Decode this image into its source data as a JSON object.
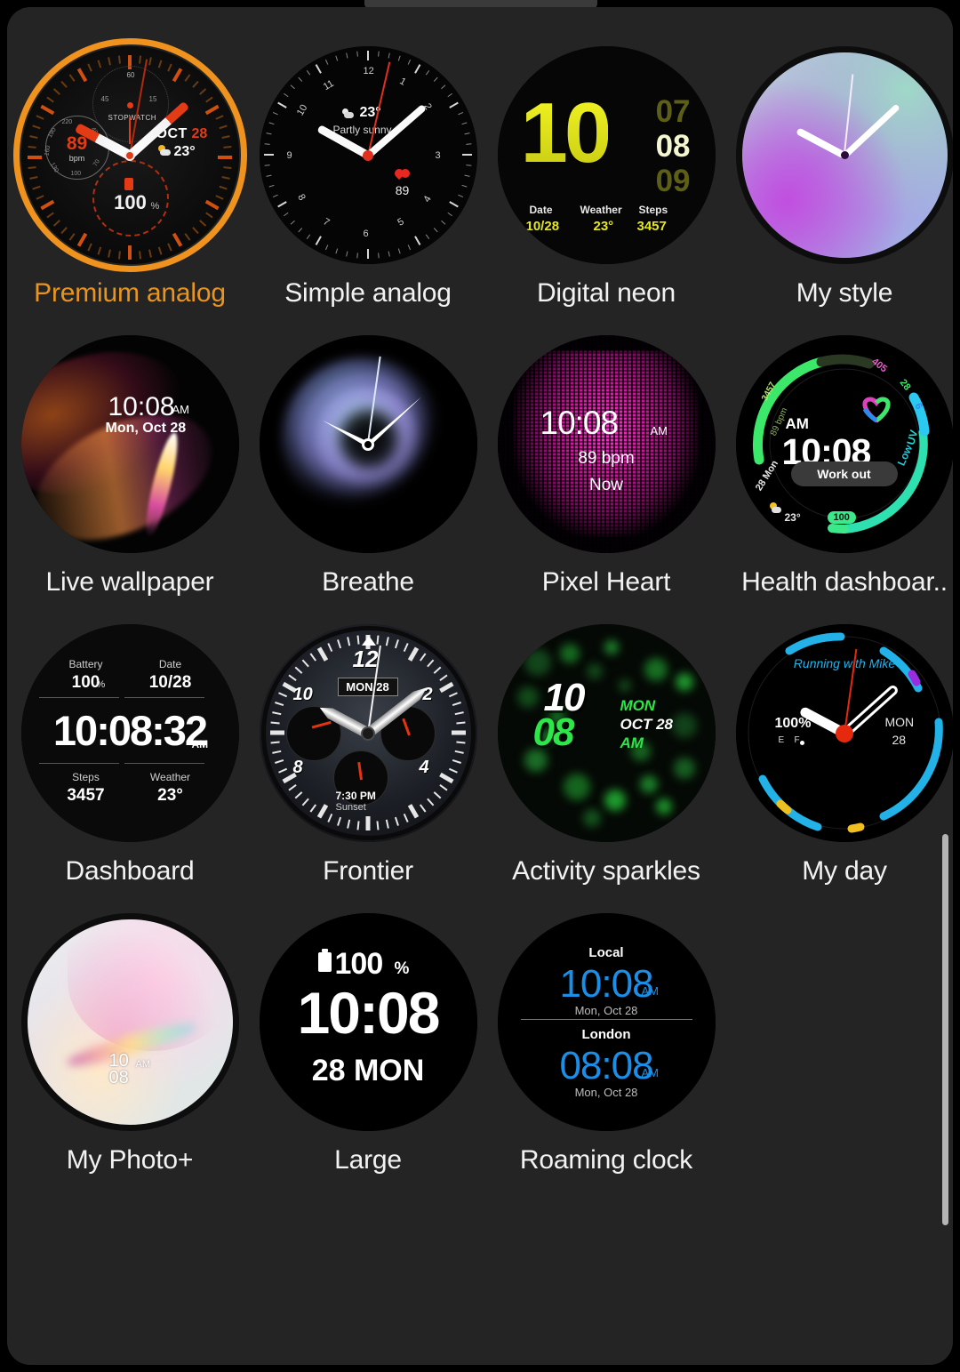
{
  "screen": {
    "background": "#000000",
    "panel_background": "#242424",
    "selected_color": "#e8941f",
    "label_color": "#f2f2f2"
  },
  "scrollbar": {
    "name": "vertical-scrollbar"
  },
  "watch_faces": [
    {
      "id": "premium-analog",
      "label": "Premium analog",
      "selected": true,
      "complications": {
        "stopwatch_label": "STOPWATCH",
        "stopwatch_ticks": [
          "60",
          "45",
          "15"
        ],
        "bpm_value": "89",
        "bpm_unit": "bpm",
        "bpm_scale": [
          "220",
          "190",
          "160",
          "130",
          "100",
          "70",
          "40"
        ],
        "date_month": "OCT",
        "date_day": "28",
        "temperature": "23°",
        "battery": "100",
        "battery_unit": "%"
      }
    },
    {
      "id": "simple-analog",
      "label": "Simple analog",
      "selected": false,
      "complications": {
        "hour_numerals": [
          "12",
          "1",
          "2",
          "3",
          "4",
          "5",
          "6",
          "7",
          "8",
          "9",
          "10",
          "11"
        ],
        "temperature": "23°",
        "weather_text": "Partly sunny",
        "heart_rate": "89"
      }
    },
    {
      "id": "digital-neon",
      "label": "Digital neon",
      "selected": false,
      "complications": {
        "hour": "10",
        "minutes_prev": "07",
        "minutes_current": "08",
        "minutes_next": "09",
        "date_caption": "Date",
        "date_value": "10/28",
        "weather_caption": "Weather",
        "weather_value": "23°",
        "steps_caption": "Steps",
        "steps_value": "3457"
      }
    },
    {
      "id": "my-style",
      "label": "My style",
      "selected": false,
      "complications": {}
    },
    {
      "id": "live-wallpaper",
      "label": "Live wallpaper",
      "selected": false,
      "complications": {
        "time": "10:08",
        "meridiem": "AM",
        "date": "Mon, Oct 28"
      }
    },
    {
      "id": "breathe",
      "label": "Breathe",
      "selected": false,
      "complications": {}
    },
    {
      "id": "pixel-heart",
      "label": "Pixel Heart",
      "selected": false,
      "complications": {
        "time": "10:08",
        "meridiem": "AM",
        "bpm": "89 bpm",
        "status": "Now"
      }
    },
    {
      "id": "health-dashboard",
      "label": "Health dashboar..",
      "selected": false,
      "complications": {
        "steps": "3457",
        "bpm": "89 bpm",
        "calories": "405",
        "distance": "28",
        "floors": "6",
        "meridiem": "AM",
        "time": "10:08",
        "button": "Work out",
        "date": "28 Mon",
        "temperature": "23°",
        "uv_label": "UV",
        "uv_level": "Low",
        "battery": "100"
      }
    },
    {
      "id": "dashboard",
      "label": "Dashboard",
      "selected": false,
      "complications": {
        "battery_caption": "Battery",
        "battery_value": "100",
        "battery_unit": "%",
        "date_caption": "Date",
        "date_value": "10/28",
        "time": "10:08:32",
        "meridiem": "AM",
        "steps_caption": "Steps",
        "steps_value": "3457",
        "weather_caption": "Weather",
        "weather_value": "23°"
      }
    },
    {
      "id": "frontier",
      "label": "Frontier",
      "selected": false,
      "complications": {
        "numeral_12": "12",
        "numeral_10": "10",
        "numeral_8": "8",
        "numeral_4": "4",
        "numeral_2": "2",
        "date": "MON 28",
        "sunset_time": "7:30 PM",
        "sunset_label": "Sunset"
      }
    },
    {
      "id": "activity-sparkles",
      "label": "Activity sparkles",
      "selected": false,
      "complications": {
        "hour": "10",
        "minute": "08",
        "weekday": "MON",
        "date": "OCT  28",
        "meridiem": "AM"
      }
    },
    {
      "id": "my-day",
      "label": "My day",
      "selected": false,
      "complications": {
        "event": "Running with Mike",
        "battery": "100%",
        "gauge_empty": "E",
        "gauge_full": "F",
        "weekday": "MON",
        "day": "28"
      }
    },
    {
      "id": "my-photo-plus",
      "label": "My Photo+",
      "selected": false,
      "complications": {
        "hour": "10",
        "minute": "08",
        "meridiem": "AM"
      }
    },
    {
      "id": "large",
      "label": "Large",
      "selected": false,
      "complications": {
        "battery": "100",
        "battery_unit": "%",
        "time": "10:08",
        "date": "28 MON"
      }
    },
    {
      "id": "roaming-clock",
      "label": "Roaming clock",
      "selected": false,
      "complications": {
        "local_label": "Local",
        "local_time": "10:08",
        "local_meridiem": "AM",
        "local_date": "Mon, Oct 28",
        "remote_label": "London",
        "remote_time": "08:08",
        "remote_meridiem": "AM",
        "remote_date": "Mon, Oct 28"
      }
    }
  ]
}
